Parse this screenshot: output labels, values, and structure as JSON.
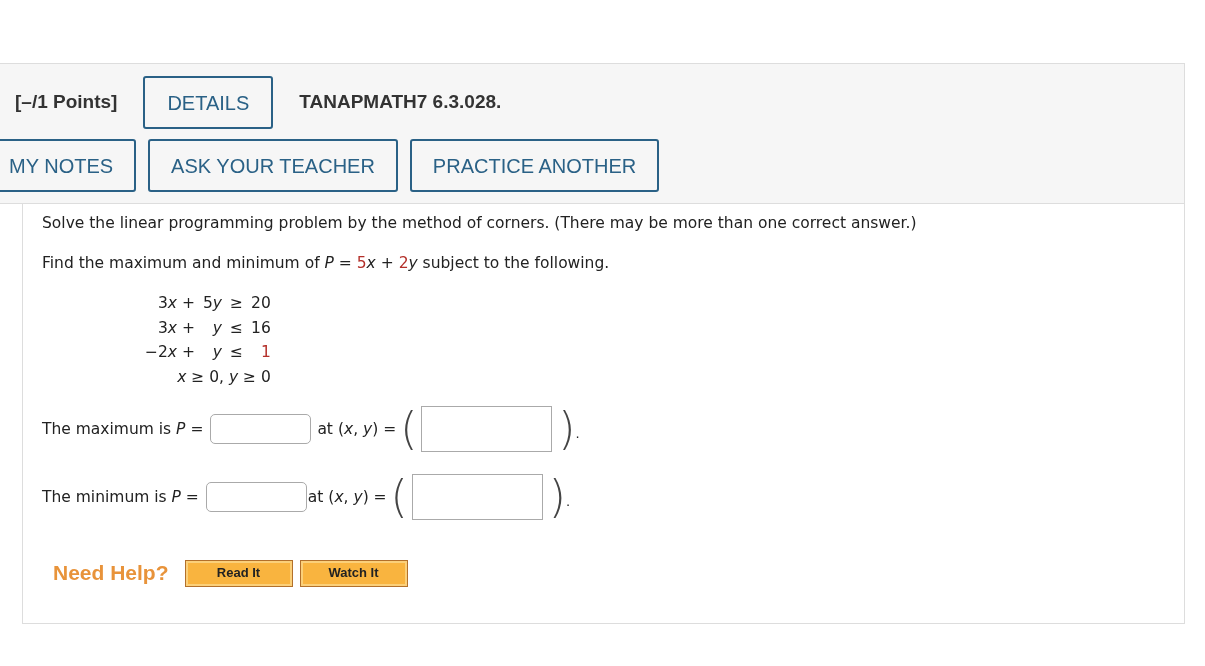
{
  "header": {
    "points": "[–/1 Points]",
    "details_button": "DETAILS",
    "problem_id": "TANAPMATH7 6.3.028.",
    "buttons": [
      "MY NOTES",
      "ASK YOUR TEACHER",
      "PRACTICE ANOTHER"
    ]
  },
  "question": {
    "instruction": "Solve the linear programming problem by the method of corners. (There may be more than one correct answer.)",
    "objective": [
      {
        "text": "Find the maximum and minimum of *P* = ",
        "kind": "text"
      },
      {
        "text": "5",
        "kind": "given"
      },
      {
        "text": "*x* + ",
        "kind": "text"
      },
      {
        "text": "2",
        "kind": "given"
      },
      {
        "text": "*y* subject to the following.",
        "kind": "text"
      }
    ],
    "constraints": [
      {
        "cells": [
          {
            "parts": [
              "3",
              "*x* +"
            ],
            "kind": "text"
          },
          {
            "parts": [
              "5",
              "*y*"
            ],
            "kind": "text"
          },
          {
            "text": "≥",
            "kind": "text"
          },
          {
            "text": "20",
            "kind": "text"
          }
        ]
      },
      {
        "cells": [
          {
            "parts": [
              "3",
              "*x* +"
            ],
            "kind": "text"
          },
          {
            "text": "*y*",
            "kind": "text"
          },
          {
            "text": "≤",
            "kind": "text"
          },
          {
            "text": "16",
            "kind": "text"
          }
        ]
      },
      {
        "cells": [
          {
            "parts": [
              "−2",
              "*x* +"
            ],
            "kind": "text"
          },
          {
            "text": "*y*",
            "kind": "text"
          },
          {
            "text": "≤",
            "kind": "text"
          },
          {
            "text": "1",
            "kind": "given"
          }
        ]
      },
      {
        "cells": [
          {
            "text": "*x* ≥ 0, *y* ≥ 0",
            "kind": "text"
          }
        ]
      }
    ],
    "answers": [
      {
        "label": "The maximum is *P* =",
        "at_label": "at (*x*, *y*) =",
        "open_paren": "(",
        "close_paren": ")",
        "period": "."
      },
      {
        "label": "The minimum is *P* =",
        "at_label": "at (*x*, *y*) =",
        "open_paren": "(",
        "close_paren": ")",
        "period": "."
      }
    ]
  },
  "help": {
    "label": "Need Help?",
    "buttons": [
      "Read It",
      "Watch It"
    ]
  }
}
